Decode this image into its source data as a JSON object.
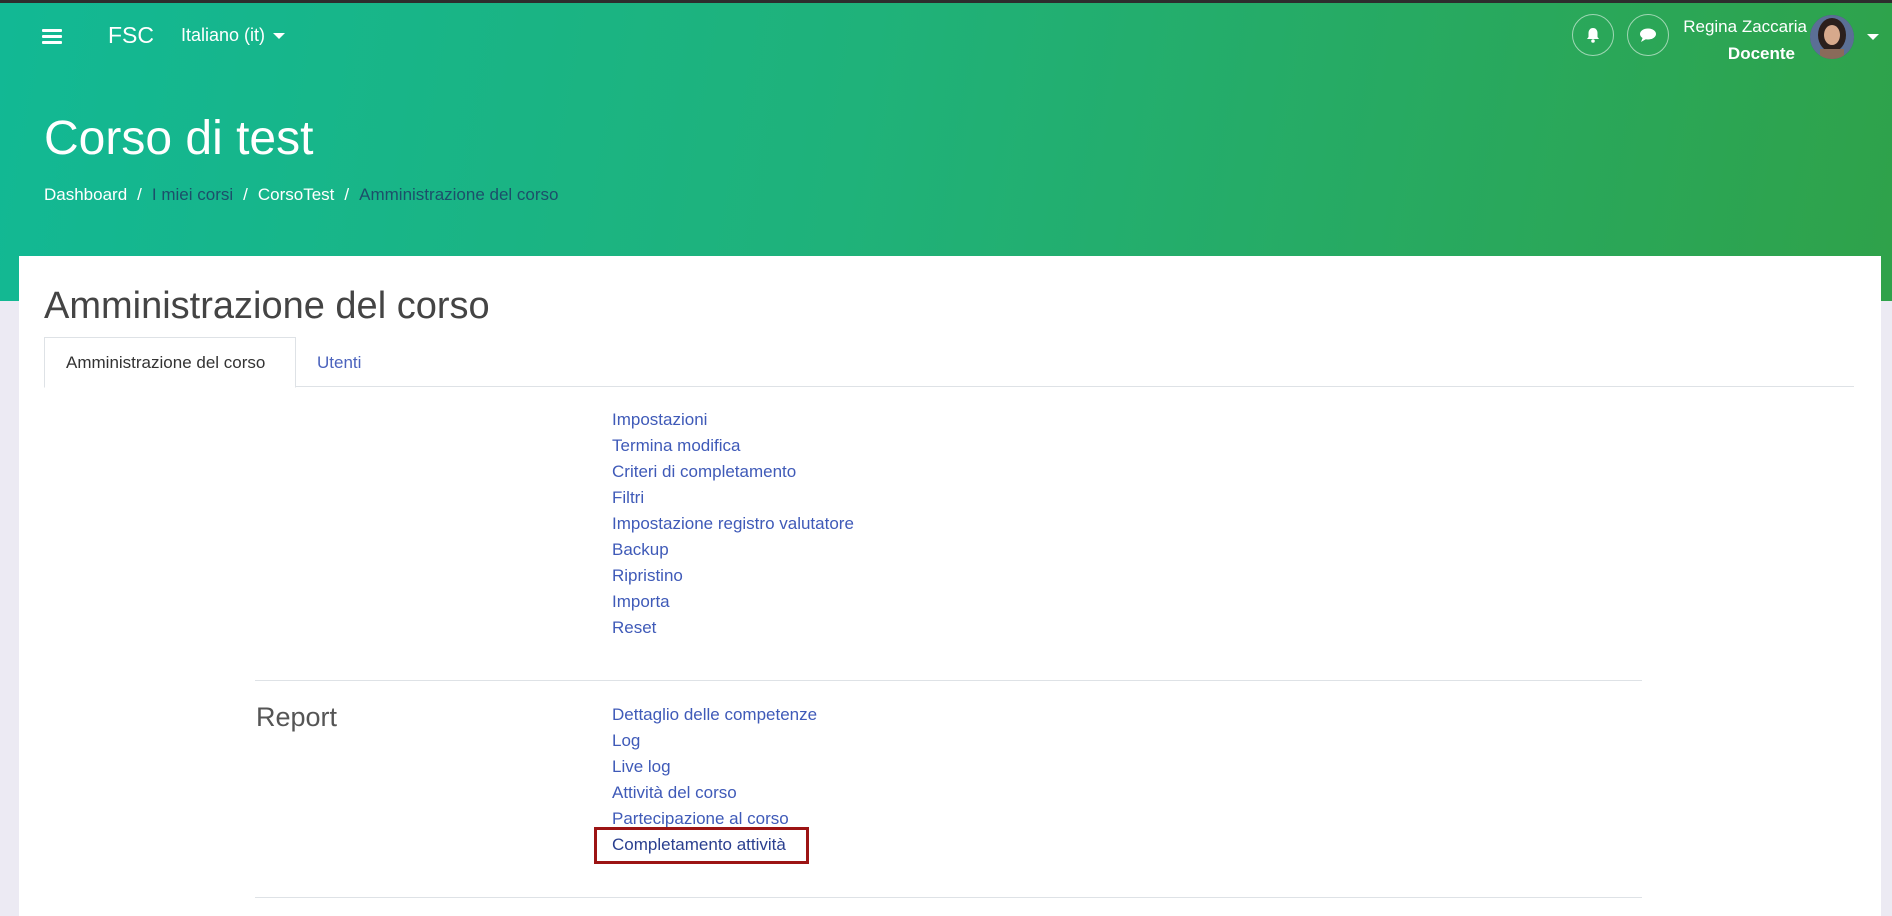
{
  "navbar": {
    "brand": "FSC",
    "language": "Italiano (it)",
    "user_name": "Regina Zaccaria",
    "user_role": "Docente",
    "icons": [
      "hamburger-menu-icon",
      "bell-icon",
      "chat-icon",
      "avatar",
      "chevron-down-icon"
    ]
  },
  "header": {
    "course_title": "Corso di test",
    "breadcrumb": [
      "Dashboard",
      "I miei corsi",
      "CorsoTest",
      "Amministrazione del corso"
    ]
  },
  "main": {
    "heading": "Amministrazione del corso",
    "tabs": [
      {
        "label": "Amministrazione del corso",
        "active": true
      },
      {
        "label": "Utenti",
        "active": false
      }
    ],
    "course_links": [
      "Impostazioni",
      "Termina modifica",
      "Criteri di completamento",
      "Filtri",
      "Impostazione registro valutatore",
      "Backup",
      "Ripristino",
      "Importa",
      "Reset"
    ],
    "report_section": {
      "title": "Report",
      "links": [
        "Dettaglio delle competenze",
        "Log",
        "Live log",
        "Attività del corso",
        "Partecipazione al corso",
        "Completamento attività"
      ]
    }
  },
  "colors": {
    "header_gradient_start": "#12b894",
    "header_gradient_end": "#2fa24a",
    "link": "#3f5ab8",
    "highlight_box": "#9c1414"
  }
}
